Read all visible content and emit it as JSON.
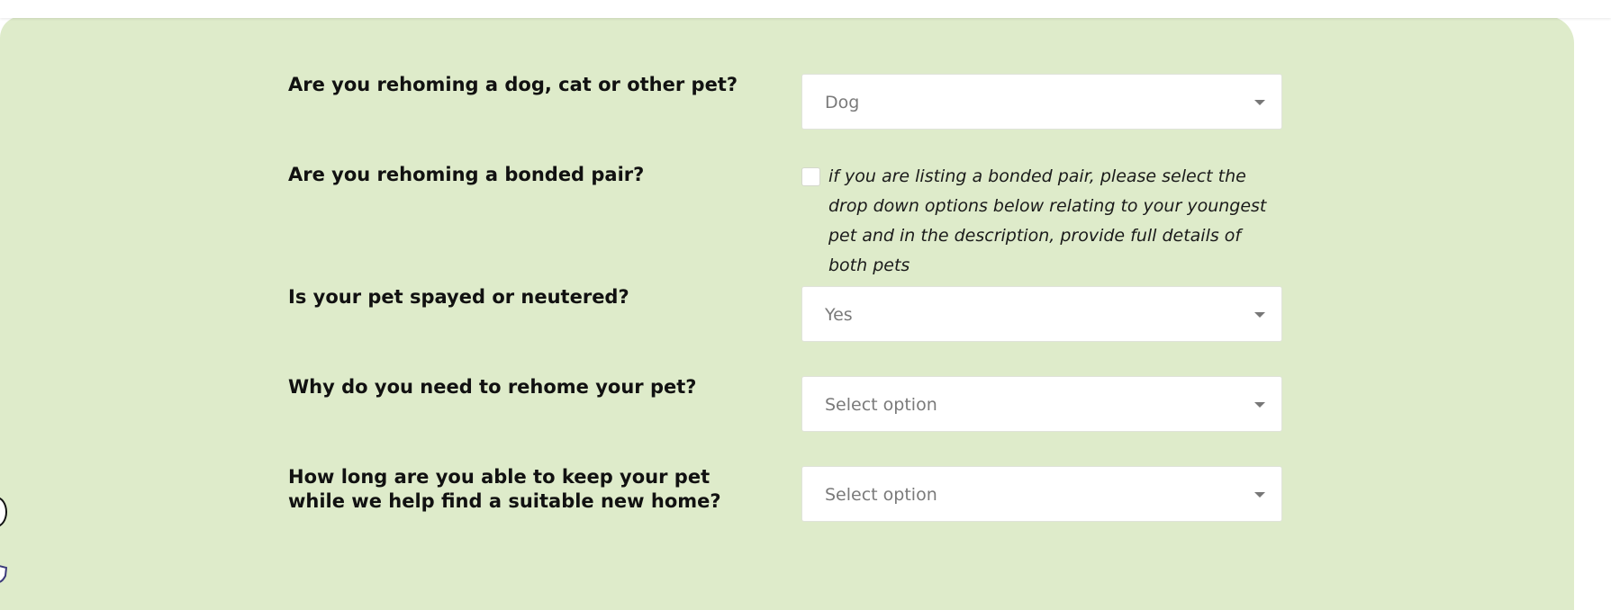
{
  "form": {
    "pet_type": {
      "question": "Are you rehoming a dog, cat or other pet?",
      "value": "Dog"
    },
    "bonded_pair": {
      "question": "Are you rehoming a bonded pair?",
      "checked": false,
      "note": "if you are listing a bonded pair, please select the drop down options below relating to your youngest pet and in the description, provide full details of both pets"
    },
    "spayed": {
      "question": "Is your pet spayed or neutered?",
      "value": "Yes"
    },
    "reason": {
      "question": "Why do you need to rehome your pet?",
      "value": "Select option"
    },
    "keep_duration": {
      "question": "How long are you able to keep your pet while we help find a suitable new home?",
      "value": "Select option"
    }
  },
  "icons": {
    "caret": "chevron-down-icon",
    "side_1": "circle-icon",
    "side_2": "shield-icon"
  },
  "colors": {
    "panel_background": "#deebca",
    "text": "#111111",
    "placeholder": "#7a7a7a"
  }
}
